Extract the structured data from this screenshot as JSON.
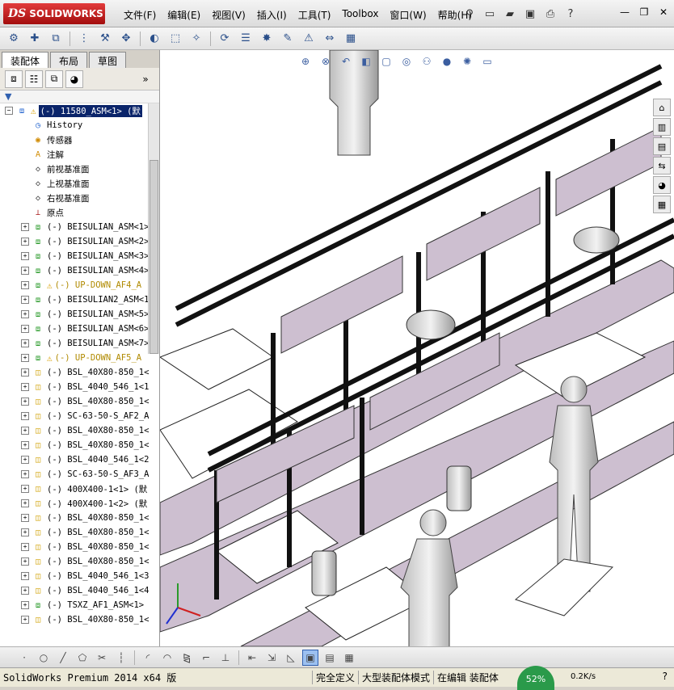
{
  "app": {
    "logo_text": "SOLIDWORKS",
    "logo_mark": "DS"
  },
  "menu": [
    "文件(F)",
    "编辑(E)",
    "视图(V)",
    "插入(I)",
    "工具(T)",
    "Toolbox",
    "窗口(W)",
    "帮助(H)"
  ],
  "panel": {
    "tabs": [
      "装配体",
      "布局",
      "草图"
    ],
    "active_tab": "装配体"
  },
  "tree": {
    "root": "(-) 11580_ASM<1> (默",
    "items": [
      {
        "label": "History",
        "icon": "history-icon",
        "expand": false,
        "warn": false,
        "yellow": false,
        "indent": 1
      },
      {
        "label": "传感器",
        "icon": "sensor-icon",
        "expand": false,
        "warn": false,
        "yellow": false,
        "indent": 1
      },
      {
        "label": "注解",
        "icon": "annotation-icon",
        "expand": false,
        "warn": false,
        "yellow": false,
        "indent": 1
      },
      {
        "label": "前视基准面",
        "icon": "plane-icon",
        "expand": false,
        "warn": false,
        "yellow": false,
        "indent": 1
      },
      {
        "label": "上视基准面",
        "icon": "plane-icon",
        "expand": false,
        "warn": false,
        "yellow": false,
        "indent": 1
      },
      {
        "label": "右视基准面",
        "icon": "plane-icon",
        "expand": false,
        "warn": false,
        "yellow": false,
        "indent": 1
      },
      {
        "label": "原点",
        "icon": "origin-icon",
        "expand": false,
        "warn": false,
        "yellow": false,
        "indent": 1
      },
      {
        "label": "(-) BEISULIAN_ASM<1>",
        "icon": "assembly-icon",
        "expand": true,
        "warn": false,
        "yellow": false,
        "indent": 0
      },
      {
        "label": "(-) BEISULIAN_ASM<2>",
        "icon": "assembly-icon",
        "expand": true,
        "warn": false,
        "yellow": false,
        "indent": 0
      },
      {
        "label": "(-) BEISULIAN_ASM<3>",
        "icon": "assembly-icon",
        "expand": true,
        "warn": false,
        "yellow": false,
        "indent": 0
      },
      {
        "label": "(-) BEISULIAN_ASM<4>",
        "icon": "assembly-icon",
        "expand": true,
        "warn": false,
        "yellow": false,
        "indent": 0
      },
      {
        "label": "(-) UP-DOWN_AF4_A",
        "icon": "assembly-icon",
        "expand": true,
        "warn": true,
        "yellow": true,
        "indent": 0
      },
      {
        "label": "(-) BEISULIAN2_ASM<1",
        "icon": "assembly-icon",
        "expand": true,
        "warn": false,
        "yellow": false,
        "indent": 0
      },
      {
        "label": "(-) BEISULIAN_ASM<5>",
        "icon": "assembly-icon",
        "expand": true,
        "warn": false,
        "yellow": false,
        "indent": 0
      },
      {
        "label": "(-) BEISULIAN_ASM<6>",
        "icon": "assembly-icon",
        "expand": true,
        "warn": false,
        "yellow": false,
        "indent": 0
      },
      {
        "label": "(-) BEISULIAN_ASM<7>",
        "icon": "assembly-icon",
        "expand": true,
        "warn": false,
        "yellow": false,
        "indent": 0
      },
      {
        "label": "(-) UP-DOWN_AF5_A",
        "icon": "assembly-icon",
        "expand": true,
        "warn": true,
        "yellow": true,
        "indent": 0
      },
      {
        "label": "(-) BSL_40X80-850_1<",
        "icon": "part-icon",
        "expand": true,
        "warn": false,
        "yellow": false,
        "indent": 0
      },
      {
        "label": "(-) BSL_4040_546_1<1",
        "icon": "part-icon",
        "expand": true,
        "warn": false,
        "yellow": false,
        "indent": 0
      },
      {
        "label": "(-) BSL_40X80-850_1<",
        "icon": "part-icon",
        "expand": true,
        "warn": false,
        "yellow": false,
        "indent": 0
      },
      {
        "label": "(-) SC-63-50-S_AF2_A",
        "icon": "part-icon",
        "expand": true,
        "warn": false,
        "yellow": false,
        "indent": 0
      },
      {
        "label": "(-) BSL_40X80-850_1<",
        "icon": "part-icon",
        "expand": true,
        "warn": false,
        "yellow": false,
        "indent": 0
      },
      {
        "label": "(-) BSL_40X80-850_1<",
        "icon": "part-icon",
        "expand": true,
        "warn": false,
        "yellow": false,
        "indent": 0
      },
      {
        "label": "(-) BSL_4040_546_1<2",
        "icon": "part-icon",
        "expand": true,
        "warn": false,
        "yellow": false,
        "indent": 0
      },
      {
        "label": "(-) SC-63-50-S_AF3_A",
        "icon": "part-icon",
        "expand": true,
        "warn": false,
        "yellow": false,
        "indent": 0
      },
      {
        "label": "(-) 400X400-1<1> (默",
        "icon": "part-icon",
        "expand": true,
        "warn": false,
        "yellow": false,
        "indent": 0
      },
      {
        "label": "(-) 400X400-1<2> (默",
        "icon": "part-icon",
        "expand": true,
        "warn": false,
        "yellow": false,
        "indent": 0
      },
      {
        "label": "(-) BSL_40X80-850_1<",
        "icon": "part-icon",
        "expand": true,
        "warn": false,
        "yellow": false,
        "indent": 0
      },
      {
        "label": "(-) BSL_40X80-850_1<",
        "icon": "part-icon",
        "expand": true,
        "warn": false,
        "yellow": false,
        "indent": 0
      },
      {
        "label": "(-) BSL_40X80-850_1<",
        "icon": "part-icon",
        "expand": true,
        "warn": false,
        "yellow": false,
        "indent": 0
      },
      {
        "label": "(-) BSL_40X80-850_1<",
        "icon": "part-icon",
        "expand": true,
        "warn": false,
        "yellow": false,
        "indent": 0
      },
      {
        "label": "(-) BSL_4040_546_1<3",
        "icon": "part-icon",
        "expand": true,
        "warn": false,
        "yellow": false,
        "indent": 0
      },
      {
        "label": "(-) BSL_4040_546_1<4",
        "icon": "part-icon",
        "expand": true,
        "warn": false,
        "yellow": false,
        "indent": 0
      },
      {
        "label": "(-) TSXZ_AF1_ASM<1>",
        "icon": "assembly-icon",
        "expand": true,
        "warn": false,
        "yellow": false,
        "indent": 0
      },
      {
        "label": "(-) BSL_40X80-850_1<",
        "icon": "part-icon",
        "expand": true,
        "warn": false,
        "yellow": false,
        "indent": 0
      }
    ]
  },
  "status": {
    "app_version": "SolidWorks Premium 2014 x64 版",
    "cells": [
      "完全定义",
      "大型装配体模式",
      "在编辑 装配体"
    ],
    "net_percent": "52%",
    "net_speed": "0.2K/s"
  },
  "colors": {
    "brand": "#c8161d",
    "frame": "#1a1a1a",
    "panel": "#cdbfd0"
  }
}
